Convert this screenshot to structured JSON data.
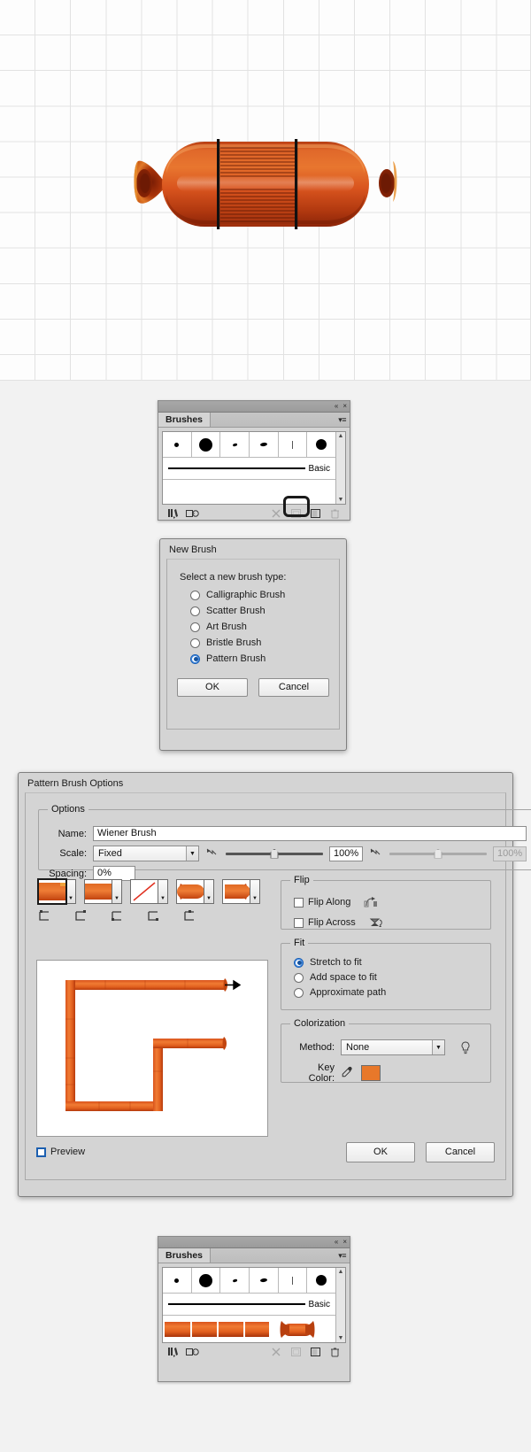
{
  "canvas": {
    "name": "artboard-grid-canvas",
    "artwork": "wiener-sausage-illustration",
    "grid_color": "#e2e2e2",
    "background": "#fdfdfd"
  },
  "brushes_panel_top": {
    "title": "Brushes",
    "collapse_icon": "«",
    "close_icon": "×",
    "menu_icon": "▾≡",
    "stroke_label": "Basic",
    "swatches": [
      "dot-tiny",
      "dot-large",
      "comma-small",
      "comma-medium",
      "hairline",
      "dot-round"
    ],
    "footer_icons": [
      "brush-libraries-icon",
      "libraries-panel-icon",
      "remove-brush-stroke-icon",
      "options-of-selected-object-icon",
      "new-brush-icon",
      "delete-brush-icon"
    ],
    "highlighted_footer_icon": "new-brush-icon"
  },
  "new_brush_dialog": {
    "title": "New Brush",
    "prompt": "Select a new brush type:",
    "options": [
      {
        "label": "Calligraphic Brush",
        "selected": false
      },
      {
        "label": "Scatter Brush",
        "selected": false
      },
      {
        "label": "Art Brush",
        "selected": false
      },
      {
        "label": "Bristle Brush",
        "selected": false
      },
      {
        "label": "Pattern Brush",
        "selected": true
      }
    ],
    "ok_label": "OK",
    "cancel_label": "Cancel"
  },
  "pattern_brush_options": {
    "title": "Pattern Brush Options",
    "options_group": {
      "legend": "Options",
      "name_label": "Name:",
      "name_value": "Wiener Brush",
      "scale_label": "Scale:",
      "scale_value": "Fixed",
      "scale_percent": "100%",
      "scale_percent_secondary": "100%",
      "spacing_label": "Spacing:",
      "spacing_value": "0%"
    },
    "tiles": [
      {
        "name": "side-tile",
        "selected": true
      },
      {
        "name": "outer-corner-tile",
        "selected": false
      },
      {
        "name": "inner-corner-tile",
        "selected": false
      },
      {
        "name": "start-tile",
        "selected": false
      },
      {
        "name": "end-tile",
        "selected": false
      }
    ],
    "flip_group": {
      "legend": "Flip",
      "flip_along_label": "Flip Along",
      "flip_along_checked": false,
      "flip_across_label": "Flip Across",
      "flip_across_checked": false
    },
    "fit_group": {
      "legend": "Fit",
      "options": [
        {
          "label": "Stretch to fit",
          "selected": true
        },
        {
          "label": "Add space to fit",
          "selected": false
        },
        {
          "label": "Approximate path",
          "selected": false
        }
      ]
    },
    "colorization_group": {
      "legend": "Colorization",
      "method_label": "Method:",
      "method_value": "None",
      "key_color_label": "Key Color:",
      "key_color_hex": "#e8782a",
      "eyedropper_icon": "eyedropper-icon",
      "tip_icon": "lightbulb-icon"
    },
    "preview_label": "Preview",
    "preview_checked": false,
    "ok_label": "OK",
    "cancel_label": "Cancel"
  },
  "brushes_panel_bottom": {
    "title": "Brushes",
    "collapse_icon": "«",
    "close_icon": "×",
    "menu_icon": "▾≡",
    "stroke_label": "Basic",
    "swatches": [
      "dot-tiny",
      "dot-large",
      "comma-small",
      "comma-medium",
      "hairline",
      "dot-round"
    ],
    "pattern_brush_row": "wiener-pattern-brush",
    "footer_icons": [
      "brush-libraries-icon",
      "libraries-panel-icon",
      "remove-brush-stroke-icon",
      "options-of-selected-object-icon",
      "new-brush-icon",
      "delete-brush-icon"
    ]
  },
  "colors": {
    "sausage_mid": "#d9541e",
    "sausage_light": "#ef7d3c",
    "sausage_dark": "#a8300d",
    "sausage_deep": "#8c2408",
    "highlight": "#f08a46",
    "panel_bg": "#d4d4d4",
    "accent_blue": "#1c5fb0"
  }
}
